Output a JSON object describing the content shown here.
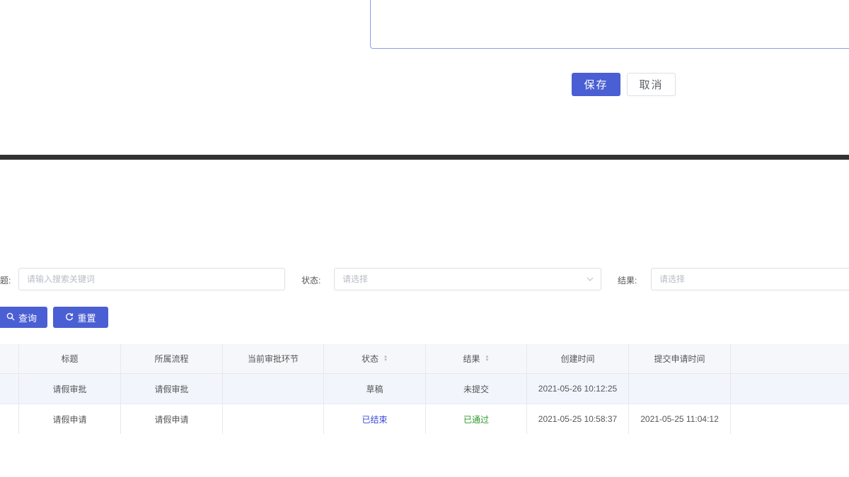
{
  "form": {
    "save_label": "保存",
    "cancel_label": "取消"
  },
  "search": {
    "title_label": "题:",
    "title_placeholder": "请输入搜索关键词",
    "status_label": "状态:",
    "status_placeholder": "请选择",
    "result_label": "结果:",
    "result_placeholder": "请选择",
    "query_label": "查询",
    "reset_label": "重置"
  },
  "table": {
    "headers": [
      "标题",
      "所属流程",
      "当前审批环节",
      "状态",
      "结果",
      "创建时间",
      "提交申请时间"
    ],
    "rows": [
      {
        "title": "请假审批",
        "process": "请假审批",
        "node": "",
        "status": "草稿",
        "result": "未提交",
        "created": "2021-05-26 10:12:25",
        "submitted": ""
      },
      {
        "title": "请假申请",
        "process": "请假申请",
        "node": "",
        "status": "已结束",
        "result": "已通过",
        "created": "2021-05-25 10:58:37",
        "submitted": "2021-05-25 11:04:12"
      }
    ]
  },
  "colors": {
    "primary": "#4a5fd3",
    "status_ended": "#3a4bd8",
    "result_passed": "#2a9a2a"
  }
}
